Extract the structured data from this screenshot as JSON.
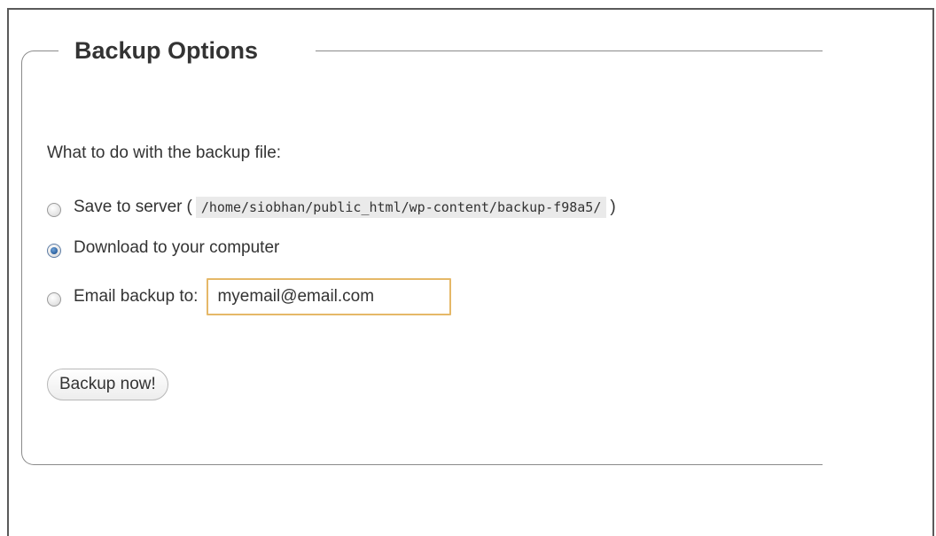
{
  "section": {
    "legend": "Backup Options"
  },
  "form": {
    "prompt": "What to do with the backup file:",
    "options": [
      {
        "label": "Save to server",
        "paren_open": "(",
        "path": "/home/siobhan/public_html/wp-content/backup-f98a5/",
        "paren_close": ")",
        "checked": false
      },
      {
        "label": "Download to your computer",
        "checked": true
      },
      {
        "label": "Email backup to:",
        "checked": false
      }
    ],
    "email": {
      "value": "myemail@email.com"
    },
    "submit_label": "Backup now!"
  },
  "colors": {
    "input_focus_border": "#e5b868",
    "radio_selected": "#2b5f9e",
    "code_background": "#eaeaea"
  }
}
